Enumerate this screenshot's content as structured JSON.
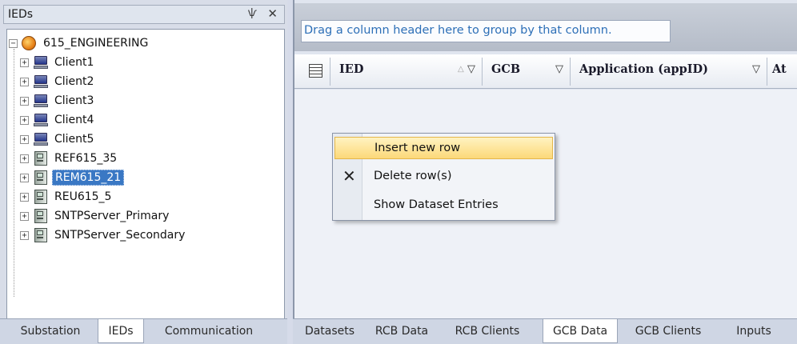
{
  "ieds_pane": {
    "title": "IEDs",
    "pin_glyph": "ѱ",
    "close_glyph": "✕",
    "tree": {
      "root": "615_ENGINEERING",
      "items": [
        {
          "label": "Client1",
          "icon": "computer-icon"
        },
        {
          "label": "Client2",
          "icon": "computer-icon"
        },
        {
          "label": "Client3",
          "icon": "computer-icon"
        },
        {
          "label": "Client4",
          "icon": "computer-icon"
        },
        {
          "label": "Client5",
          "icon": "computer-icon"
        },
        {
          "label": "REF615_35",
          "icon": "ied-device-icon"
        },
        {
          "label": "REM615_21",
          "icon": "ied-device-icon",
          "selected": true
        },
        {
          "label": "REU615_5",
          "icon": "ied-device-icon"
        },
        {
          "label": "SNTPServer_Primary",
          "icon": "ied-device-icon"
        },
        {
          "label": "SNTPServer_Secondary",
          "icon": "ied-device-icon"
        }
      ]
    },
    "tabs": [
      "Substation",
      "IEDs",
      "Communication"
    ],
    "active_tab": "IEDs"
  },
  "grid": {
    "group_hint": "Drag a column header here to group by that column.",
    "columns": [
      "IED",
      "GCB",
      "Application (appID)",
      "At"
    ]
  },
  "context_menu": {
    "items": [
      "Insert new row",
      "Delete row(s)",
      "Show Dataset Entries"
    ],
    "highlighted": "Insert new row"
  },
  "bottom_tabs": {
    "items": [
      "Datasets",
      "RCB Data",
      "RCB Clients",
      "GCB Data",
      "GCB Clients",
      "Inputs"
    ],
    "active": "GCB Data"
  },
  "colors": {
    "selection": "#3a78c4",
    "hint_text": "#2d6fb7",
    "menu_highlight": "#fcd879"
  }
}
